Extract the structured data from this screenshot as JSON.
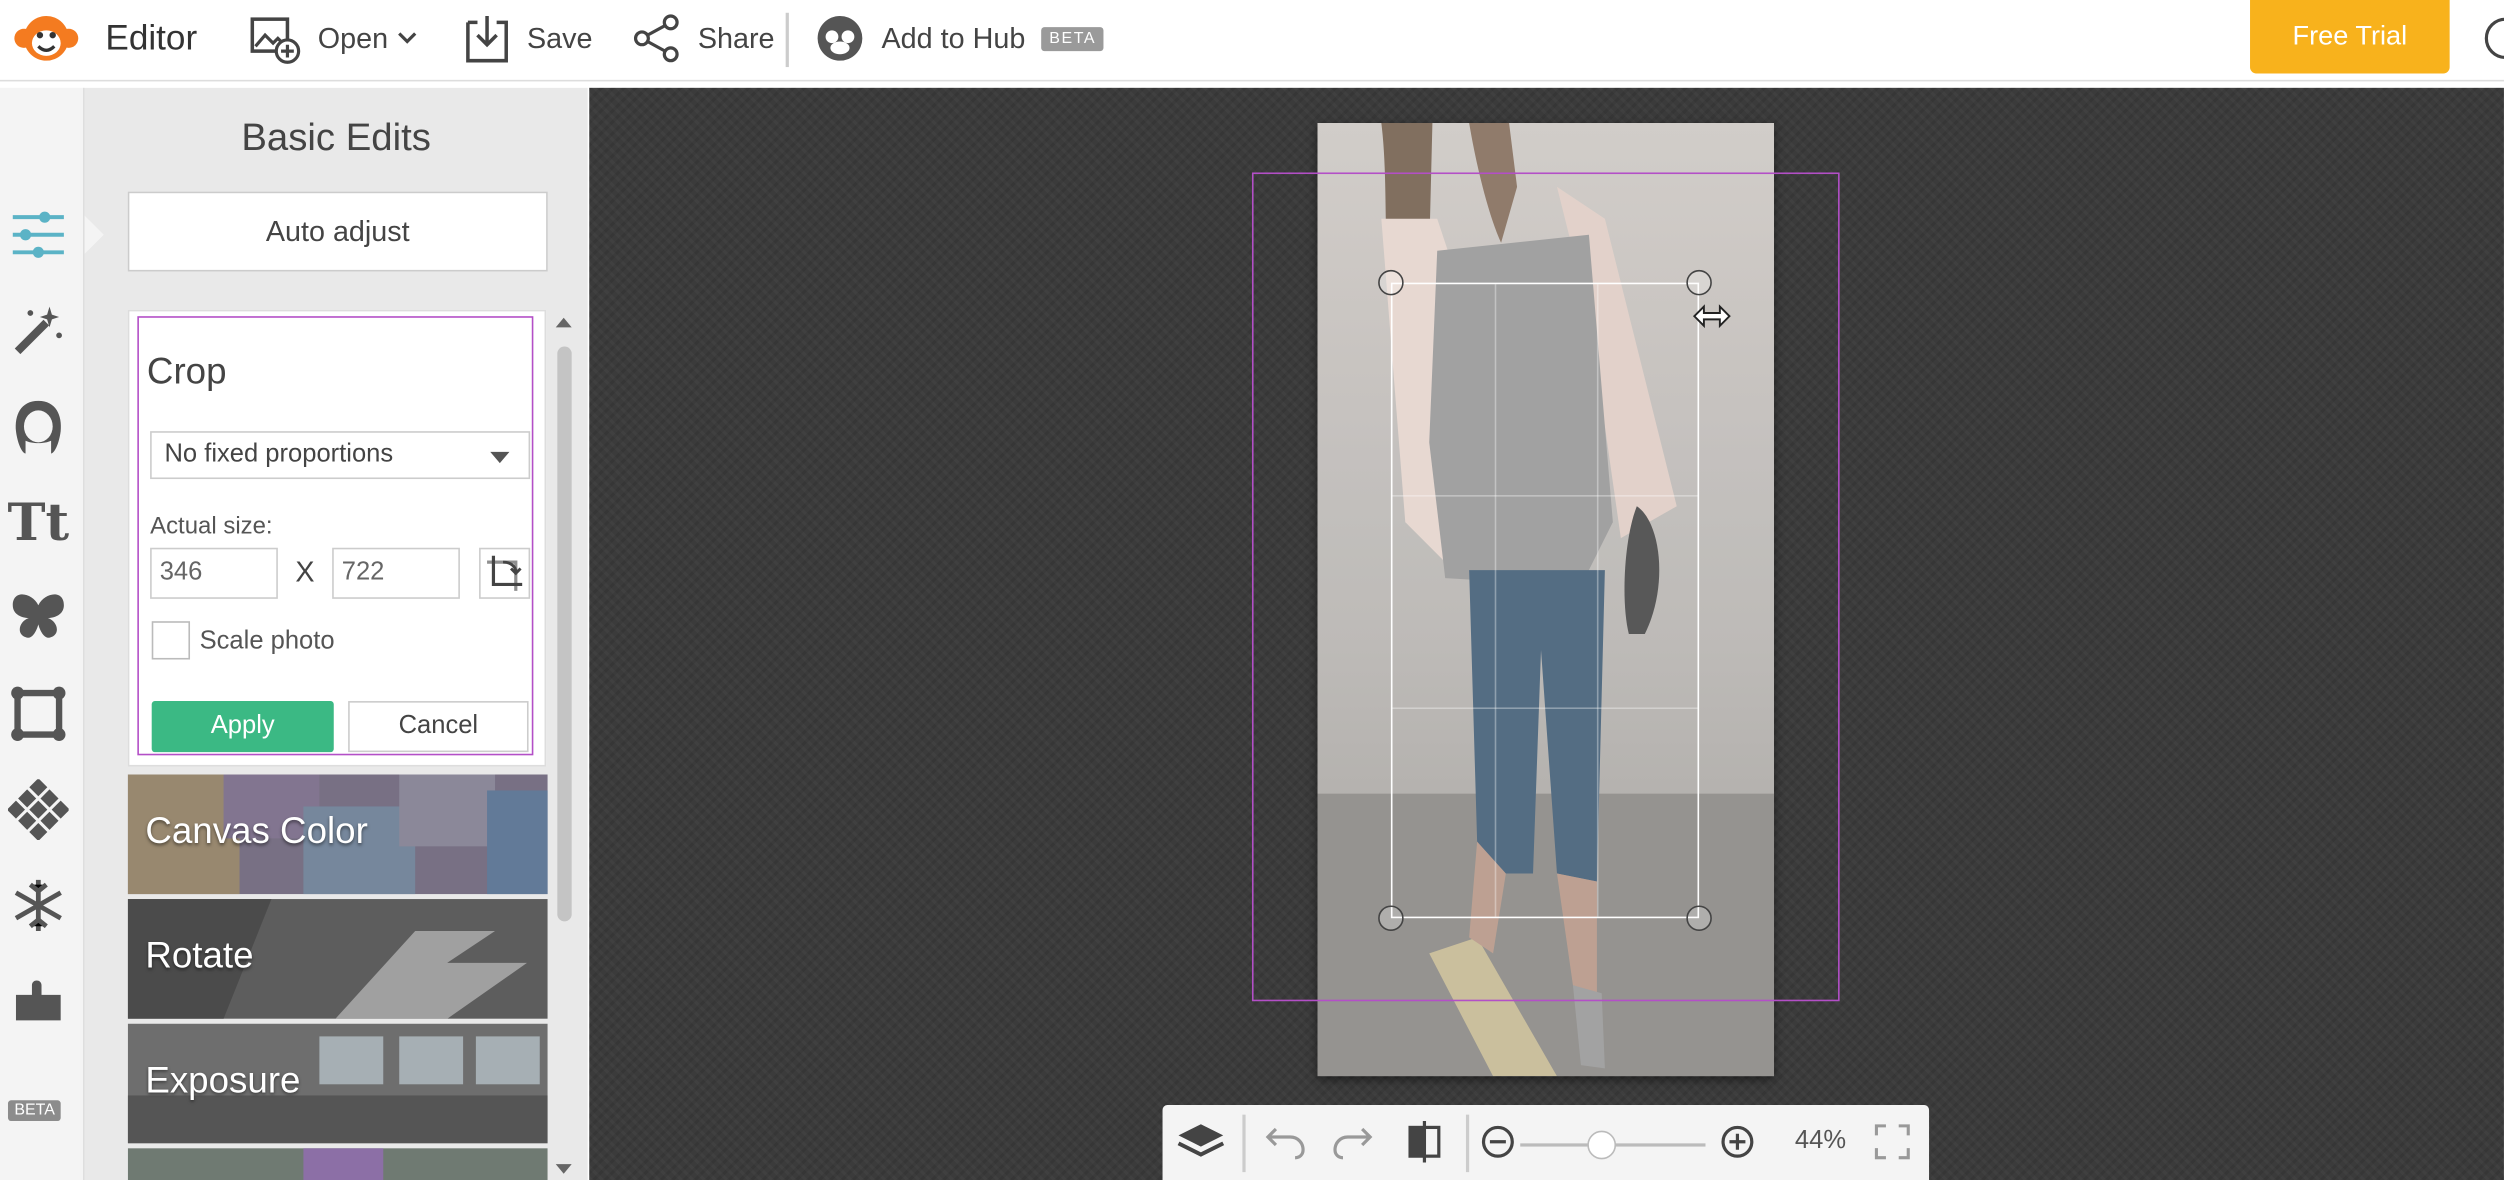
{
  "app": {
    "title": "Editor"
  },
  "topbar": {
    "open_label": "Open",
    "save_label": "Save",
    "share_label": "Share",
    "hub_label": "Add to Hub",
    "hub_badge": "BETA",
    "free_trial_label": "Free Trial"
  },
  "rail": {
    "icons": [
      "sliders-icon",
      "magic-wand-icon",
      "face-icon",
      "text-icon",
      "butterfly-icon",
      "frame-icon",
      "texture-icon",
      "snowflake-icon",
      "puzzle-icon"
    ],
    "beta_badge": "BETA"
  },
  "panel": {
    "title": "Basic Edits",
    "auto_adjust_label": "Auto adjust",
    "crop": {
      "title": "Crop",
      "proportion_selected": "No fixed proportions",
      "size_label": "Actual size:",
      "width_value": "346",
      "height_value": "722",
      "separator": "X",
      "scale_label": "Scale photo",
      "scale_checked": false,
      "apply_label": "Apply",
      "cancel_label": "Cancel"
    },
    "tools": [
      {
        "label": "Canvas Color"
      },
      {
        "label": "Rotate"
      },
      {
        "label": "Exposure"
      }
    ]
  },
  "bottombar": {
    "zoom_text": "44%",
    "zoom_level": 0.44
  },
  "colors": {
    "accent_orange": "#f8b21c",
    "apply_green": "#3bb984",
    "guide_magenta": "#b34fc7",
    "canvas_bg": "#3b3b3b"
  }
}
